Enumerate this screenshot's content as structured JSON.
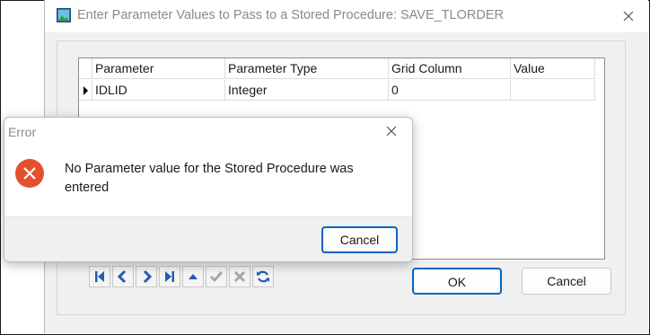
{
  "main_dialog": {
    "title": "Enter Parameter Values to Pass to a Stored Procedure: SAVE_TLORDER",
    "grid": {
      "columns": [
        "Parameter",
        "Parameter Type",
        "Grid Column",
        "Value"
      ],
      "rows": [
        {
          "parameter": "IDLID",
          "parameter_type": "Integer",
          "grid_column": "0",
          "value": ""
        }
      ]
    },
    "navigator": [
      "first-record-icon",
      "prior-record-icon",
      "next-record-icon",
      "last-record-icon",
      "edit-icon",
      "post-check-icon",
      "cancel-x-icon",
      "refresh-icon"
    ],
    "ok_label": "OK",
    "cancel_label": "Cancel"
  },
  "error_dialog": {
    "title": "Error",
    "message": "No Parameter value for the Stored Procedure was entered",
    "cancel_label": "Cancel"
  },
  "colors": {
    "accent": "#0067c0",
    "error_red": "#e4502f",
    "nav_blue": "#1e5fb5"
  }
}
